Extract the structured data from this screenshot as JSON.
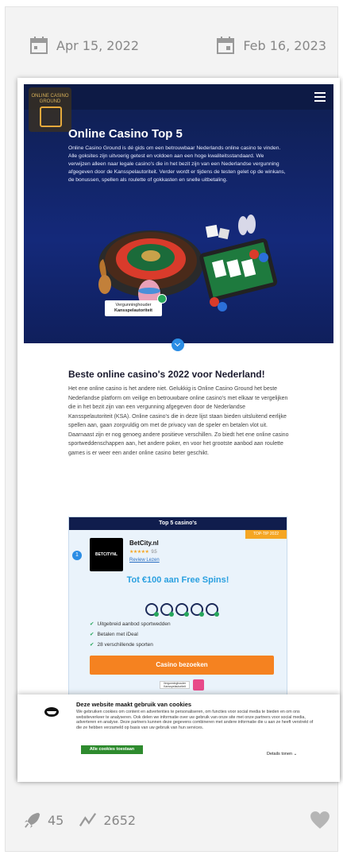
{
  "dates": {
    "created": "Apr 15, 2022",
    "updated": "Feb 16, 2023"
  },
  "screenshot": {
    "logo_text": "ONLINE CASINO GROUND",
    "hero": {
      "title": "Online Casino Top 5",
      "intro": "Online Casino Ground is dé gids om een betrouwbaar Nederlands online casino te vinden. Alle goksites zijn uitvoerig getest en voldoen aan een hoge kwaliteitsstandaard. We verwijzen alleen naar legale casino's die in het bezit zijn van een Nederlandse vergunning afgegeven door de Kansspelautoriteit. Verder wordt er tijdens de testen gelet op de winkans, de bonussen, spellen als roulette of gokkasten en snelle uitbetaling.",
      "badge_line1": "Vergunninghouder",
      "badge_line2": "Kansspelautoriteit"
    },
    "content": {
      "heading": "Beste online casino's 2022 voor Nederland!",
      "body": "Het ene online casino is het andere niet. Gelukkig is Online Casino Ground het beste Nederlandse platform om veilige en betrouwbare online casino's met elkaar te vergelijken die in het bezit zijn van een vergunning afgegeven door de Nederlandse Kansspelautoriteit (KSA). Online casino's die in deze lijst staan bieden uitsluitend eerlijke spellen aan, gaan zorgvuldig om met de privacy van de speler en betalen vlot uit. Daarnaast zijn er nog genoeg andere positieve verschillen. Zo biedt het ene online casino sportweddenschappen aan, het andere poker, en voor het grootste aanbod aan roulette games is er weer een ander online casino beter geschikt."
    },
    "top5": {
      "header": "Top 5 casino's",
      "tag": "TOP-TIP 2022",
      "rank": "1",
      "logo_label": "BETCITYNL",
      "name": "BetCity.nl",
      "stars": "★★★★★",
      "rating": "9.5",
      "review_link": "Review Lezen",
      "bonus": "Tot €100 aan Free Spins!",
      "features": [
        "Uitgebreid aanbod sportwedden",
        "Betalen met iDeal",
        "28 verschillende sporten"
      ],
      "cta": "Casino bezoeken",
      "ksa_small": "Vergunninghouder Kansspelautoriteit"
    },
    "cookie": {
      "title": "Deze website maakt gebruik van cookies",
      "text": "We gebruiken cookies om content en advertenties te personaliseren, om functies voor social media te bieden en om ons websiteverkeer te analyseren. Ook delen we informatie over uw gebruik van onze site met onze partners voor social media, adverteren en analyse. Deze partners kunnen deze gegevens combineren met andere informatie die u aan ze heeft verstrekt of die ze hebben verzameld op basis van uw gebruik van hun services.",
      "allow_button": "Alle cookies toestaan",
      "details_link": "Details tonen ⌄"
    }
  },
  "stats": {
    "launches": "45",
    "views": "2652"
  },
  "colors": {
    "accent_orange": "#f58220",
    "hero_navy": "#14297a",
    "bonus_blue": "#2aa0e0",
    "muted_gray": "#888888"
  }
}
